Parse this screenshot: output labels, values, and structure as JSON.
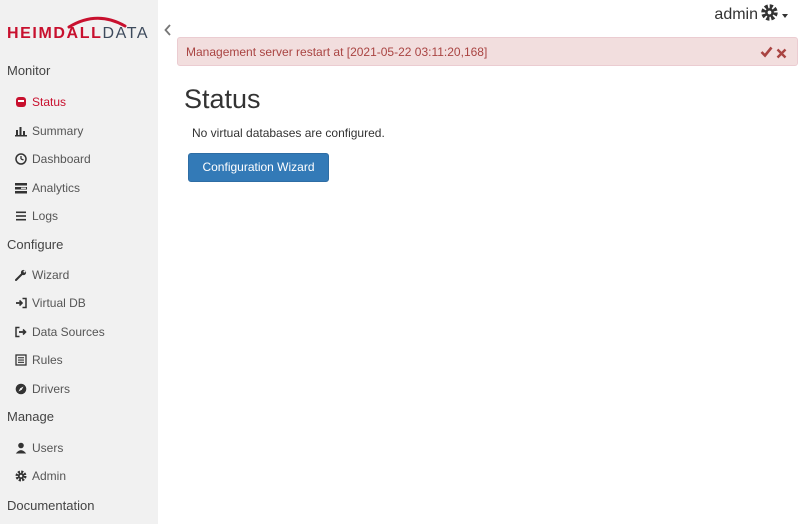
{
  "brand": {
    "part1": "HEIMDALL",
    "part2": "DATA",
    "color": "#c8102e"
  },
  "sidebar": {
    "sections": [
      {
        "title": "Monitor",
        "items": [
          {
            "label": "Status",
            "icon": "status-icon",
            "active": true
          },
          {
            "label": "Summary",
            "icon": "bar-chart-icon"
          },
          {
            "label": "Dashboard",
            "icon": "dashboard-icon"
          },
          {
            "label": "Analytics",
            "icon": "analytics-icon"
          },
          {
            "label": "Logs",
            "icon": "list-icon"
          }
        ]
      },
      {
        "title": "Configure",
        "items": [
          {
            "label": "Wizard",
            "icon": "wrench-icon"
          },
          {
            "label": "Virtual DB",
            "icon": "sign-in-icon"
          },
          {
            "label": "Data Sources",
            "icon": "sign-out-icon"
          },
          {
            "label": "Rules",
            "icon": "list-alt-icon"
          },
          {
            "label": "Drivers",
            "icon": "compass-icon"
          }
        ]
      },
      {
        "title": "Manage",
        "items": [
          {
            "label": "Users",
            "icon": "user-icon"
          },
          {
            "label": "Admin",
            "icon": "gear-icon"
          }
        ]
      }
    ],
    "footer": "Documentation"
  },
  "topbar": {
    "username": "admin"
  },
  "alert": {
    "text": "Management server restart at [2021-05-22 03:11:20,168]"
  },
  "main": {
    "title": "Status",
    "message": "No virtual databases are configured.",
    "button": "Configuration Wizard"
  },
  "colors": {
    "accent": "#337ab7",
    "danger": "#a94442",
    "alertBg": "#f2dede"
  }
}
